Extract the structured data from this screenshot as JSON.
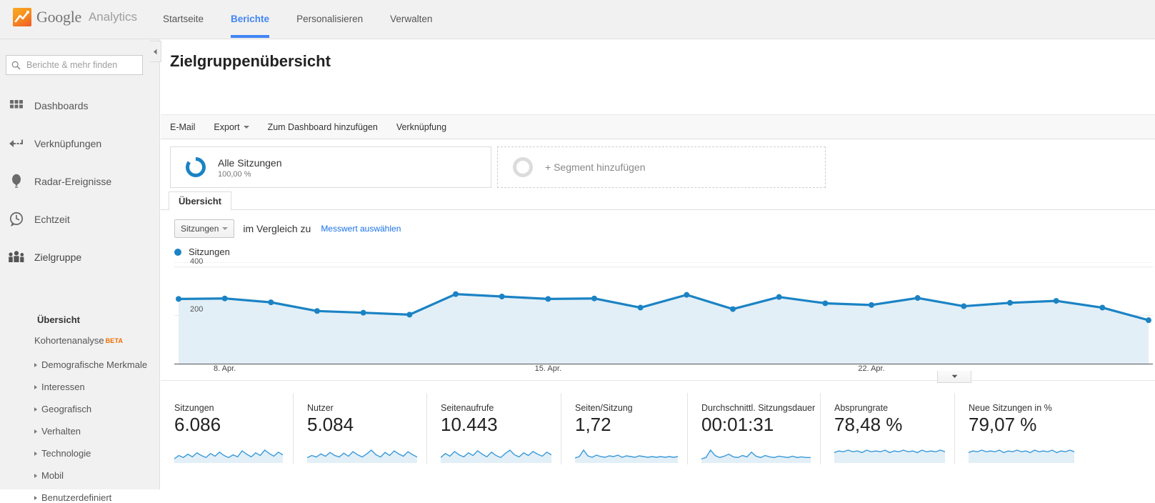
{
  "brand": {
    "google": "Google",
    "analytics": "Analytics",
    "logo_icon": "analytics-logo-icon"
  },
  "topnav": {
    "items": [
      {
        "label": "Startseite",
        "active": false
      },
      {
        "label": "Berichte",
        "active": true
      },
      {
        "label": "Personalisieren",
        "active": false
      },
      {
        "label": "Verwalten",
        "active": false
      }
    ],
    "accent": "#4285f4"
  },
  "sidebar": {
    "search": {
      "placeholder": "Berichte & mehr finden",
      "icon": "search-icon"
    },
    "collapse_icon": "chevron-left-icon",
    "main_items": [
      {
        "label": "Dashboards",
        "icon": "dashboards-grid-icon"
      },
      {
        "label": "Verknüpfungen",
        "icon": "shortcut-arrow-icon"
      },
      {
        "label": "Radar-Ereignisse",
        "icon": "radar-balloon-icon"
      },
      {
        "label": "Echtzeit",
        "icon": "clock-icon"
      },
      {
        "label": "Zielgruppe",
        "icon": "audience-people-icon"
      }
    ],
    "sub_items": [
      {
        "label": "Übersicht",
        "current": true,
        "expandable": false,
        "badge": null
      },
      {
        "label": "Kohortenanalyse",
        "current": false,
        "expandable": false,
        "badge": "BETA"
      },
      {
        "label": "Demografische Merkmale",
        "current": false,
        "expandable": true,
        "badge": null
      },
      {
        "label": "Interessen",
        "current": false,
        "expandable": true,
        "badge": null
      },
      {
        "label": "Geografisch",
        "current": false,
        "expandable": true,
        "badge": null
      },
      {
        "label": "Verhalten",
        "current": false,
        "expandable": true,
        "badge": null
      },
      {
        "label": "Technologie",
        "current": false,
        "expandable": true,
        "badge": null
      },
      {
        "label": "Mobil",
        "current": false,
        "expandable": true,
        "badge": null
      },
      {
        "label": "Benutzerdefiniert",
        "current": false,
        "expandable": true,
        "badge": null
      }
    ],
    "beta_color": "#ef6c00"
  },
  "page": {
    "title": "Zielgruppenübersicht"
  },
  "actionbar": {
    "email": "E-Mail",
    "export": "Export",
    "add_to_dashboard": "Zum Dashboard hinzufügen",
    "shortcut": "Verknüpfung"
  },
  "segments": {
    "all_sessions_name": "Alle Sitzungen",
    "all_sessions_pct": "100,00 %",
    "add_segment_label": "+ Segment hinzufügen",
    "donut_color": "#1b83c4"
  },
  "tabs": [
    {
      "label": "Übersicht",
      "active": true
    }
  ],
  "metric_selector": {
    "selected": "Sitzungen",
    "compare_label": "im Vergleich zu",
    "choose_metric_link": "Messwert auswählen"
  },
  "chart_data": {
    "type": "area",
    "title": "",
    "series_name": "Sitzungen",
    "line_color": "#1b83c4",
    "fill_color": "#e2eff7",
    "xlabel": "",
    "ylabel": "",
    "ylim": [
      0,
      420
    ],
    "yticks": [
      200,
      400
    ],
    "grid": true,
    "legend_position": "top-left",
    "x_tick_labels": [
      "8. Apr.",
      "15. Apr.",
      "22. Apr."
    ],
    "x_tick_indices": [
      1,
      8,
      15
    ],
    "x": [
      "7. Apr.",
      "8. Apr.",
      "9. Apr.",
      "10. Apr.",
      "11. Apr.",
      "12. Apr.",
      "13. Apr.",
      "14. Apr.",
      "15. Apr.",
      "16. Apr.",
      "17. Apr.",
      "18. Apr.",
      "19. Apr.",
      "20. Apr.",
      "21. Apr.",
      "22. Apr.",
      "23. Apr.",
      "24. Apr.",
      "25. Apr.",
      "26. Apr.",
      "27. Apr.",
      "28. Apr."
    ],
    "values": [
      268,
      270,
      254,
      218,
      211,
      203,
      288,
      278,
      268,
      270,
      232,
      285,
      226,
      276,
      250,
      243,
      272,
      238,
      252,
      260,
      232,
      180
    ]
  },
  "chart_collapse_icon": "chevron-down-icon",
  "summary_cards": [
    {
      "label": "Sitzungen",
      "value": "6.086",
      "spark": [
        4,
        9,
        6,
        11,
        7,
        13,
        9,
        6,
        12,
        8,
        14,
        9,
        6,
        10,
        7,
        16,
        11,
        7,
        13,
        9,
        17,
        12,
        8,
        14,
        10
      ]
    },
    {
      "label": "Nutzer",
      "value": "5.084",
      "spark": [
        5,
        8,
        6,
        10,
        7,
        12,
        8,
        6,
        11,
        7,
        13,
        9,
        6,
        10,
        15,
        9,
        6,
        12,
        8,
        14,
        10,
        7,
        13,
        9,
        6
      ]
    },
    {
      "label": "Seitenaufrufe",
      "value": "10.443",
      "spark": [
        6,
        12,
        8,
        15,
        10,
        7,
        13,
        9,
        16,
        11,
        7,
        14,
        9,
        6,
        12,
        17,
        10,
        7,
        13,
        9,
        15,
        11,
        8,
        14,
        10
      ]
    },
    {
      "label": "Seiten/Sitzung",
      "value": "1,72",
      "spark": [
        5,
        7,
        16,
        8,
        6,
        9,
        7,
        6,
        8,
        7,
        9,
        6,
        8,
        7,
        6,
        8,
        7,
        6,
        7,
        6,
        7,
        6,
        7,
        6,
        7
      ]
    },
    {
      "label": "Durchschnittl. Sitzungsdauer",
      "value": "00:01:31",
      "spark": [
        4,
        6,
        17,
        9,
        6,
        8,
        11,
        7,
        6,
        9,
        7,
        14,
        8,
        6,
        9,
        7,
        6,
        8,
        7,
        6,
        8,
        6,
        7,
        6,
        6
      ]
    },
    {
      "label": "Absprungrate",
      "value": "78,48 %",
      "spark": [
        11,
        13,
        12,
        14,
        12,
        13,
        11,
        14,
        12,
        13,
        12,
        14,
        11,
        13,
        12,
        14,
        12,
        13,
        11,
        14,
        12,
        13,
        12,
        14,
        12
      ]
    },
    {
      "label": "Neue Sitzungen in %",
      "value": "79,07 %",
      "spark": [
        11,
        13,
        12,
        14,
        12,
        13,
        12,
        14,
        11,
        13,
        12,
        14,
        12,
        13,
        11,
        14,
        12,
        13,
        12,
        14,
        11,
        13,
        12,
        14,
        12
      ]
    }
  ],
  "colors": {
    "accent_blue": "#1b83c4",
    "link_blue": "#1a73e8",
    "nav_blue": "#4285f4",
    "chart_fill": "#e2eff7",
    "chrome_gray": "#f1f1f1"
  }
}
